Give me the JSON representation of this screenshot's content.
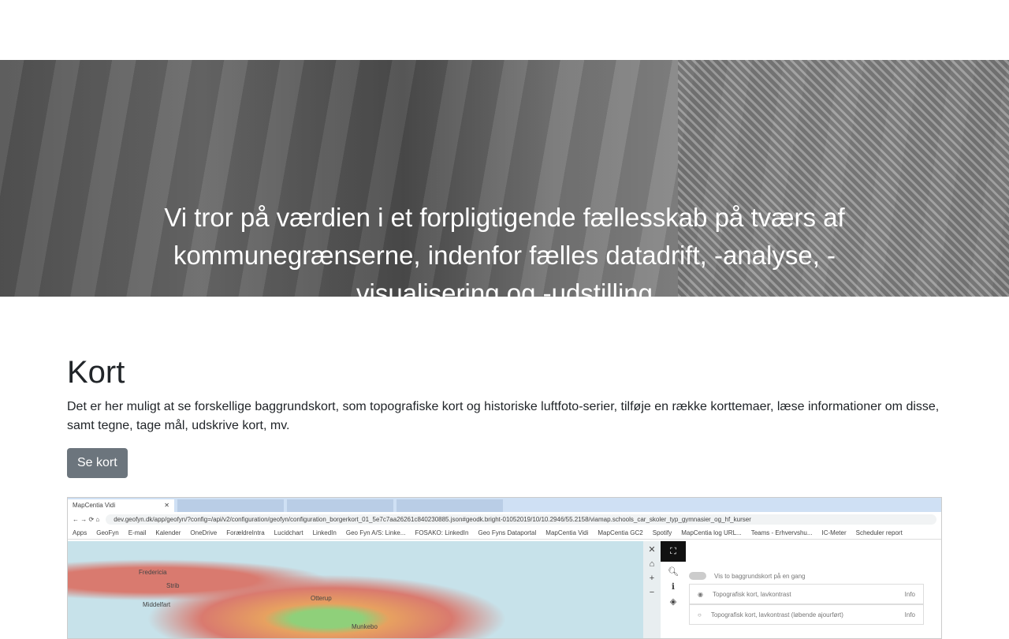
{
  "hero": {
    "text": "Vi tror på værdien i et forpligtigende fællesskab på tværs af kommunegrænserne, indenfor fælles datadrift, -analyse, -visualisering og -udstilling"
  },
  "section": {
    "title": "Kort",
    "description": "Det er her muligt at se forskellige baggrundskort, som topografiske kort og historiske luftfoto-serier, tilføje en række korttemaer, læse informationer om disse, samt tegne, tage mål, udskrive kort, mv.",
    "button": "Se kort"
  },
  "screenshot": {
    "tab": "MapCentia Vidi",
    "url": "dev.geofyn.dk/app/geofyn/?config=/api/v2/configuration/geofyn/configuration_borgerkort_01_5e7c7aa26261c840230885.json#geodk.bright-01052019/10/10.2946/55.2158/viamap.schools_car_skoler_typ_gymnasier_og_hf_kurser",
    "bookmarks": [
      "Apps",
      "GeoFyn",
      "E-mail",
      "Kalender",
      "OneDrive",
      "ForældreIntra",
      "Lucidchart",
      "LinkedIn",
      "Geo Fyn A/S: Linke...",
      "FOSAKO: LinkedIn",
      "Geo Fyns Dataportal",
      "MapCentia Vidi",
      "MapCentia GC2",
      "Spotify",
      "MapCentia log URL...",
      "Teams - Erhvervshu...",
      "IC-Meter",
      "Scheduler report"
    ],
    "map_labels": [
      "Fredericia",
      "Strib",
      "Middelfart",
      "Otterup",
      "Munkebo"
    ],
    "toggle_label": "Vis to baggrundskort på en gang",
    "layers": [
      {
        "name": "Topografisk kort, lavkontrast",
        "info": "Info"
      },
      {
        "name": "Topografisk kort, lavkontrast (løbende ajourført)",
        "info": "Info"
      }
    ]
  }
}
